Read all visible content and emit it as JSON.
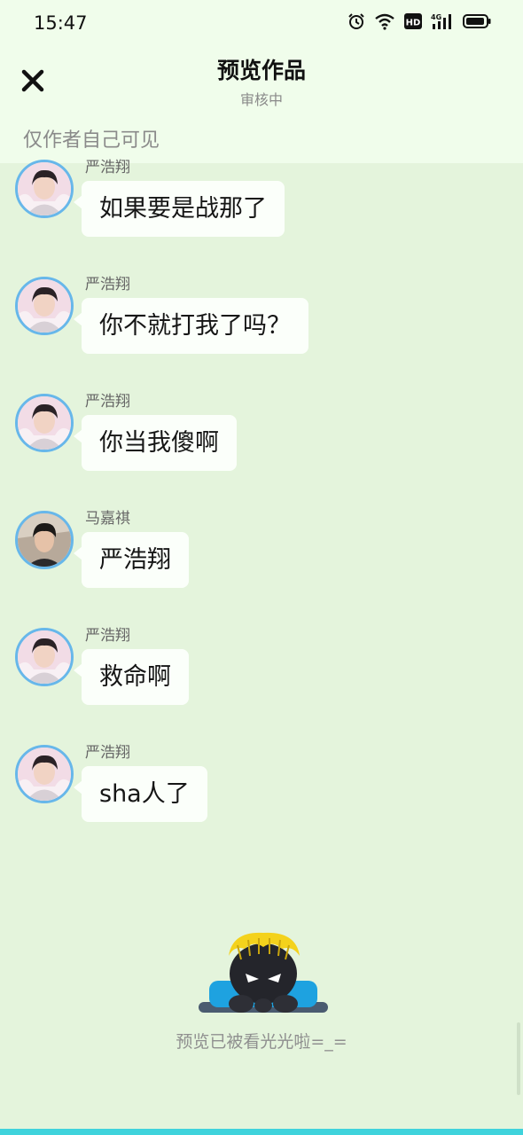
{
  "status_bar": {
    "time": "15:47",
    "icons": [
      "alarm-icon",
      "wifi-icon",
      "hd-icon",
      "4g-signal-icon",
      "battery-icon"
    ],
    "hd_label": "HD",
    "network_label": "4G"
  },
  "header": {
    "title": "预览作品",
    "subtitle": "审核中",
    "visibility_note": "仅作者自己可见",
    "close_icon": "close-icon"
  },
  "messages": [
    {
      "sender": "严浩翔",
      "text": "如果要是战那了"
    },
    {
      "sender": "严浩翔",
      "text": "你不就打我了吗？"
    },
    {
      "sender": "严浩翔",
      "text": "你当我傻啊"
    },
    {
      "sender": "马嘉祺",
      "text": "严浩翔"
    },
    {
      "sender": "严浩翔",
      "text": "救命啊"
    },
    {
      "sender": "严浩翔",
      "text": "sha人了"
    }
  ],
  "footer": {
    "end_text": "预览已被看光光啦=_=",
    "mascot_icon": "peeking-mascot-icon"
  },
  "colors": {
    "background": "#e4f4dc",
    "header_background": "#f0fdeb",
    "avatar_ring": "#67b7ea",
    "bubble": "#fbfffa",
    "bottom_bar": "#3fd3dc"
  }
}
